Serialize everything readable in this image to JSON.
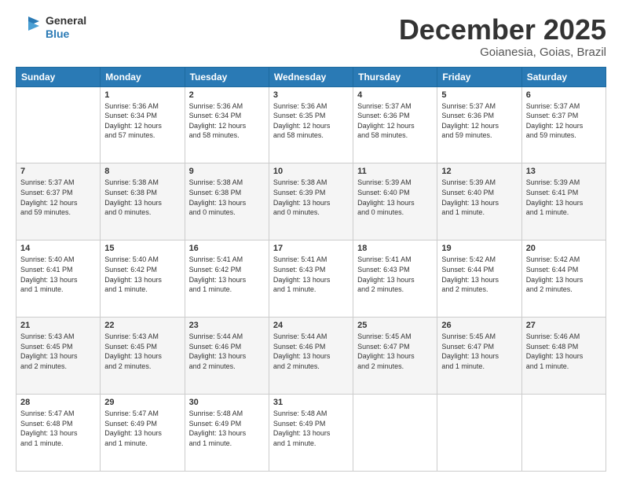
{
  "logo": {
    "line1": "General",
    "line2": "Blue"
  },
  "header": {
    "title": "December 2025",
    "subtitle": "Goianesia, Goias, Brazil"
  },
  "weekdays": [
    "Sunday",
    "Monday",
    "Tuesday",
    "Wednesday",
    "Thursday",
    "Friday",
    "Saturday"
  ],
  "weeks": [
    [
      {
        "day": "",
        "info": ""
      },
      {
        "day": "1",
        "info": "Sunrise: 5:36 AM\nSunset: 6:34 PM\nDaylight: 12 hours\nand 57 minutes."
      },
      {
        "day": "2",
        "info": "Sunrise: 5:36 AM\nSunset: 6:34 PM\nDaylight: 12 hours\nand 58 minutes."
      },
      {
        "day": "3",
        "info": "Sunrise: 5:36 AM\nSunset: 6:35 PM\nDaylight: 12 hours\nand 58 minutes."
      },
      {
        "day": "4",
        "info": "Sunrise: 5:37 AM\nSunset: 6:36 PM\nDaylight: 12 hours\nand 58 minutes."
      },
      {
        "day": "5",
        "info": "Sunrise: 5:37 AM\nSunset: 6:36 PM\nDaylight: 12 hours\nand 59 minutes."
      },
      {
        "day": "6",
        "info": "Sunrise: 5:37 AM\nSunset: 6:37 PM\nDaylight: 12 hours\nand 59 minutes."
      }
    ],
    [
      {
        "day": "7",
        "info": "Sunrise: 5:37 AM\nSunset: 6:37 PM\nDaylight: 12 hours\nand 59 minutes."
      },
      {
        "day": "8",
        "info": "Sunrise: 5:38 AM\nSunset: 6:38 PM\nDaylight: 13 hours\nand 0 minutes."
      },
      {
        "day": "9",
        "info": "Sunrise: 5:38 AM\nSunset: 6:38 PM\nDaylight: 13 hours\nand 0 minutes."
      },
      {
        "day": "10",
        "info": "Sunrise: 5:38 AM\nSunset: 6:39 PM\nDaylight: 13 hours\nand 0 minutes."
      },
      {
        "day": "11",
        "info": "Sunrise: 5:39 AM\nSunset: 6:40 PM\nDaylight: 13 hours\nand 0 minutes."
      },
      {
        "day": "12",
        "info": "Sunrise: 5:39 AM\nSunset: 6:40 PM\nDaylight: 13 hours\nand 1 minute."
      },
      {
        "day": "13",
        "info": "Sunrise: 5:39 AM\nSunset: 6:41 PM\nDaylight: 13 hours\nand 1 minute."
      }
    ],
    [
      {
        "day": "14",
        "info": "Sunrise: 5:40 AM\nSunset: 6:41 PM\nDaylight: 13 hours\nand 1 minute."
      },
      {
        "day": "15",
        "info": "Sunrise: 5:40 AM\nSunset: 6:42 PM\nDaylight: 13 hours\nand 1 minute."
      },
      {
        "day": "16",
        "info": "Sunrise: 5:41 AM\nSunset: 6:42 PM\nDaylight: 13 hours\nand 1 minute."
      },
      {
        "day": "17",
        "info": "Sunrise: 5:41 AM\nSunset: 6:43 PM\nDaylight: 13 hours\nand 1 minute."
      },
      {
        "day": "18",
        "info": "Sunrise: 5:41 AM\nSunset: 6:43 PM\nDaylight: 13 hours\nand 2 minutes."
      },
      {
        "day": "19",
        "info": "Sunrise: 5:42 AM\nSunset: 6:44 PM\nDaylight: 13 hours\nand 2 minutes."
      },
      {
        "day": "20",
        "info": "Sunrise: 5:42 AM\nSunset: 6:44 PM\nDaylight: 13 hours\nand 2 minutes."
      }
    ],
    [
      {
        "day": "21",
        "info": "Sunrise: 5:43 AM\nSunset: 6:45 PM\nDaylight: 13 hours\nand 2 minutes."
      },
      {
        "day": "22",
        "info": "Sunrise: 5:43 AM\nSunset: 6:45 PM\nDaylight: 13 hours\nand 2 minutes."
      },
      {
        "day": "23",
        "info": "Sunrise: 5:44 AM\nSunset: 6:46 PM\nDaylight: 13 hours\nand 2 minutes."
      },
      {
        "day": "24",
        "info": "Sunrise: 5:44 AM\nSunset: 6:46 PM\nDaylight: 13 hours\nand 2 minutes."
      },
      {
        "day": "25",
        "info": "Sunrise: 5:45 AM\nSunset: 6:47 PM\nDaylight: 13 hours\nand 2 minutes."
      },
      {
        "day": "26",
        "info": "Sunrise: 5:45 AM\nSunset: 6:47 PM\nDaylight: 13 hours\nand 1 minute."
      },
      {
        "day": "27",
        "info": "Sunrise: 5:46 AM\nSunset: 6:48 PM\nDaylight: 13 hours\nand 1 minute."
      }
    ],
    [
      {
        "day": "28",
        "info": "Sunrise: 5:47 AM\nSunset: 6:48 PM\nDaylight: 13 hours\nand 1 minute."
      },
      {
        "day": "29",
        "info": "Sunrise: 5:47 AM\nSunset: 6:49 PM\nDaylight: 13 hours\nand 1 minute."
      },
      {
        "day": "30",
        "info": "Sunrise: 5:48 AM\nSunset: 6:49 PM\nDaylight: 13 hours\nand 1 minute."
      },
      {
        "day": "31",
        "info": "Sunrise: 5:48 AM\nSunset: 6:49 PM\nDaylight: 13 hours\nand 1 minute."
      },
      {
        "day": "",
        "info": ""
      },
      {
        "day": "",
        "info": ""
      },
      {
        "day": "",
        "info": ""
      }
    ]
  ]
}
